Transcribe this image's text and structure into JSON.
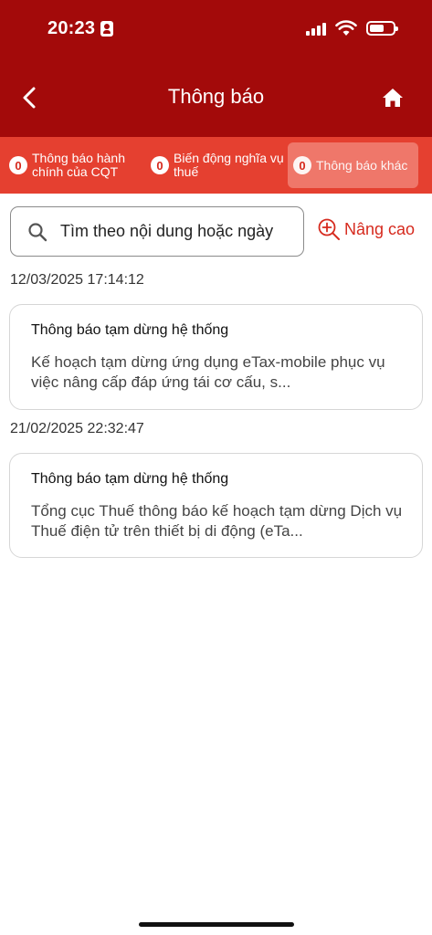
{
  "status_bar": {
    "time": "20:23"
  },
  "nav": {
    "title": "Thông báo"
  },
  "tabs": [
    {
      "count": "0",
      "label": "Thông báo hành chính của CQT"
    },
    {
      "count": "0",
      "label": "Biến động nghĩa vụ thuế"
    },
    {
      "count": "0",
      "label": "Thông báo khác"
    }
  ],
  "search": {
    "placeholder": "Tìm theo nội dung hoặc ngày",
    "advanced_label": "Nâng cao"
  },
  "notifications": [
    {
      "date": "12/03/2025 17:14:12",
      "title": "Thông báo tạm dừng hệ thống",
      "preview": "Kế hoạch tạm dừng ứng dụng eTax-mobile phục vụ việc nâng cấp đáp ứng tái cơ cấu, s..."
    },
    {
      "date": "21/02/2025 22:32:47",
      "title": "Thông báo tạm dừng hệ thống",
      "preview": "Tổng cục Thuế thông báo kế hoạch tạm dừng Dịch vụ Thuế điện tử trên thiết bị di động (eTa..."
    }
  ],
  "colors": {
    "header": "#a30a0a",
    "tab_bar": "#e54030",
    "accent": "#d62a1e"
  }
}
